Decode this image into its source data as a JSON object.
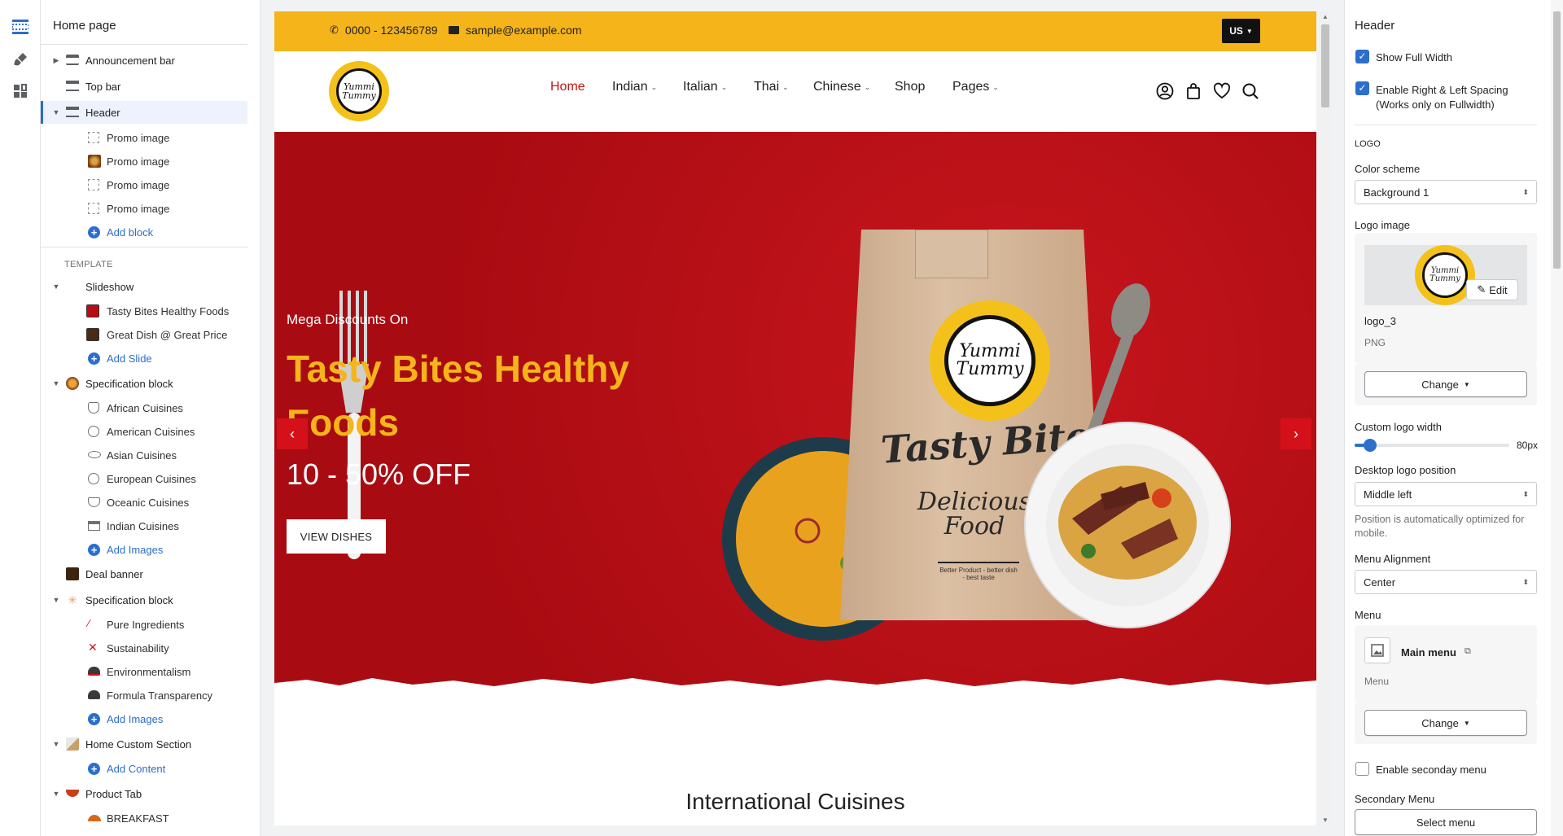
{
  "left_panel": {
    "title": "Home page",
    "header_items": [
      {
        "label": "Announcement bar"
      },
      {
        "label": "Top bar"
      },
      {
        "label": "Header"
      }
    ],
    "header_blocks": [
      {
        "label": "Promo image"
      },
      {
        "label": "Promo image"
      },
      {
        "label": "Promo image"
      },
      {
        "label": "Promo image"
      }
    ],
    "add_block": "Add block",
    "template_label": "TEMPLATE",
    "slideshow": {
      "label": "Slideshow",
      "items": [
        "Tasty Bites Healthy Foods",
        "Great Dish @ Great Price"
      ],
      "add": "Add Slide"
    },
    "spec1": {
      "label": "Specification block",
      "items": [
        "African Cuisines",
        "American Cuisines",
        "Asian Cuisines",
        "European Cuisines",
        "Oceanic Cuisines",
        "Indian Cuisines"
      ],
      "add": "Add Images"
    },
    "deal": {
      "label": "Deal banner"
    },
    "spec2": {
      "label": "Specification block",
      "items": [
        "Pure Ingredients",
        "Sustainability",
        "Environmentalism",
        "Formula Transparency"
      ],
      "add": "Add Images"
    },
    "custom": {
      "label": "Home Custom Section",
      "add": "Add Content"
    },
    "product_tab": {
      "label": "Product Tab",
      "items": [
        "BREAKFAST"
      ]
    }
  },
  "preview": {
    "topbar": {
      "phone": "0000 - 123456789",
      "email": "sample@example.com",
      "currency": "US"
    },
    "logo_text": "Yummi Tummy",
    "nav": [
      {
        "label": "Home",
        "active": true,
        "dropdown": false
      },
      {
        "label": "Indian",
        "active": false,
        "dropdown": true
      },
      {
        "label": "Italian",
        "active": false,
        "dropdown": true
      },
      {
        "label": "Thai",
        "active": false,
        "dropdown": true
      },
      {
        "label": "Chinese",
        "active": false,
        "dropdown": true
      },
      {
        "label": "Shop",
        "active": false,
        "dropdown": false
      },
      {
        "label": "Pages",
        "active": false,
        "dropdown": true
      }
    ],
    "hero": {
      "kicker": "Mega Discounts On",
      "headline": "Tasty Bites Healthy Foods",
      "offer": "10 - 50% OFF",
      "button": "VIEW DISHES",
      "bag_brand": "Yummi Tummy",
      "bag_line1": "Tasty Bite",
      "bag_line2": "Delicious Food",
      "bag_tagline": "Better Product - better dish - best taste"
    },
    "section_title": "International Cuisines",
    "colors": {
      "accent_yellow": "#f4b41a",
      "hero_red": "#b80d14",
      "nav_active": "#c71414"
    }
  },
  "right_panel": {
    "title": "Header",
    "show_full_width": {
      "label": "Show Full Width",
      "checked": true
    },
    "spacing": {
      "label": "Enable Right & Left Spacing (Works only on Fullwidth)",
      "checked": true
    },
    "logo_section": "LOGO",
    "color_scheme": {
      "label": "Color scheme",
      "value": "Background 1"
    },
    "logo_image": {
      "label": "Logo image",
      "filename": "logo_3",
      "type": "PNG",
      "edit": "Edit",
      "change": "Change"
    },
    "logo_width": {
      "label": "Custom logo width",
      "value": "80px",
      "fraction": 0.1
    },
    "logo_position": {
      "label": "Desktop logo position",
      "value": "Middle left",
      "hint": "Position is automatically optimized for mobile."
    },
    "menu_alignment": {
      "label": "Menu Alignment",
      "value": "Center"
    },
    "menu": {
      "label": "Menu",
      "name": "Main menu",
      "sub": "Menu",
      "change": "Change"
    },
    "secondary": {
      "checkbox": "Enable seconday menu",
      "checked": false,
      "label": "Secondary Menu",
      "button": "Select menu"
    }
  }
}
